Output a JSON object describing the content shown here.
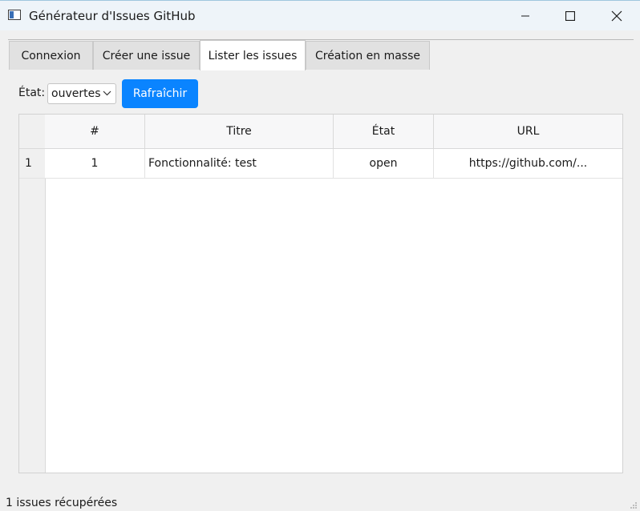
{
  "window": {
    "title": "Générateur d'Issues GitHub",
    "icon": "app-window-icon"
  },
  "tabs": [
    {
      "label": "Connexion",
      "active": false
    },
    {
      "label": "Créer une issue",
      "active": false
    },
    {
      "label": "Lister les issues",
      "active": true
    },
    {
      "label": "Création en masse",
      "active": false
    }
  ],
  "filter": {
    "state_label": "État:",
    "state_value": "ouvertes",
    "refresh_label": "Rafraîchir"
  },
  "table": {
    "columns": [
      "#",
      "Titre",
      "État",
      "URL"
    ],
    "rows": [
      {
        "row_number": "1",
        "number": "1",
        "title": "Fonctionnalité: test",
        "state": "open",
        "url": "https://github.com/..."
      }
    ]
  },
  "status_bar": {
    "text": "1 issues récupérées"
  },
  "colors": {
    "accent": "#0a84ff",
    "titlebar": "#eef4f9",
    "background": "#f0f0f0"
  }
}
